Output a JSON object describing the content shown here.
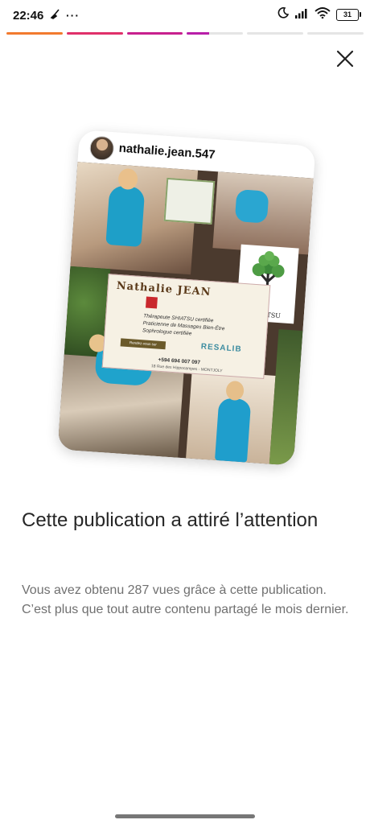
{
  "status_bar": {
    "time": "22:46",
    "left_icons": [
      "cleaner-icon",
      "more-dots-icon"
    ],
    "right_icons": [
      "moon-icon",
      "signal-icon",
      "wifi-icon",
      "battery-icon"
    ],
    "battery_level": "31"
  },
  "story_progress": {
    "segments": [
      {
        "fraction": 1.0,
        "color": "#f27a2e"
      },
      {
        "fraction": 1.0,
        "color": "#e0306a"
      },
      {
        "fraction": 1.0,
        "color": "#c8208e"
      },
      {
        "fraction": 0.4,
        "color": "#b81fa8"
      },
      {
        "fraction": 0.0,
        "color": "#e5e5e5"
      },
      {
        "fraction": 0.0,
        "color": "#e5e5e5"
      }
    ]
  },
  "post_card": {
    "username": "nathalie.jean.547",
    "flyer": {
      "name": "Nathalie  JEAN",
      "lines": [
        "Thérapeute SHIATSU certifiée",
        "Praticienne de Massages Bien-Être",
        "Sophrologue certifiée"
      ],
      "button_label": "Rendez-vous sur",
      "brand": "RESALIB",
      "phone": "+594 694 007 097",
      "address": "18 Rue des Hippocampes - MONTJOLY",
      "tree_label": "SHIATSU"
    }
  },
  "headline": "Cette publication a attiré l’attention",
  "description": "Vous avez obtenu 287 vues grâce à cette publication. C’est plus que tout autre contenu partagé le mois dernier."
}
